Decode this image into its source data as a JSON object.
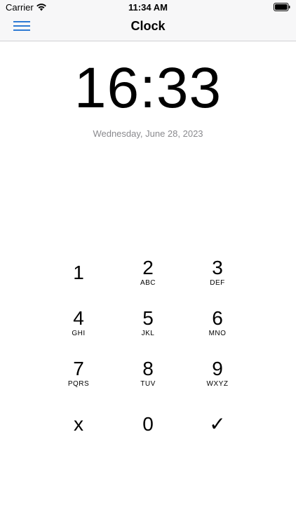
{
  "status_bar": {
    "carrier": "Carrier",
    "time": "11:34 AM",
    "wifi_icon": "wifi-icon",
    "battery_icon": "battery-icon"
  },
  "nav": {
    "title": "Clock",
    "menu_icon": "hamburger-menu-icon"
  },
  "clock": {
    "time": "16:33",
    "date": "Wednesday, June 28, 2023"
  },
  "keypad": {
    "keys": [
      {
        "digit": "1",
        "letters": ""
      },
      {
        "digit": "2",
        "letters": "ABC"
      },
      {
        "digit": "3",
        "letters": "DEF"
      },
      {
        "digit": "4",
        "letters": "GHI"
      },
      {
        "digit": "5",
        "letters": "JKL"
      },
      {
        "digit": "6",
        "letters": "MNO"
      },
      {
        "digit": "7",
        "letters": "PQRS"
      },
      {
        "digit": "8",
        "letters": "TUV"
      },
      {
        "digit": "9",
        "letters": "WXYZ"
      },
      {
        "digit": "x",
        "letters": ""
      },
      {
        "digit": "0",
        "letters": ""
      },
      {
        "digit": "✓",
        "letters": ""
      }
    ]
  },
  "colors": {
    "accent": "#2f7bd4",
    "date_text": "#8a8a8e",
    "bar_background": "#f7f7f8"
  }
}
